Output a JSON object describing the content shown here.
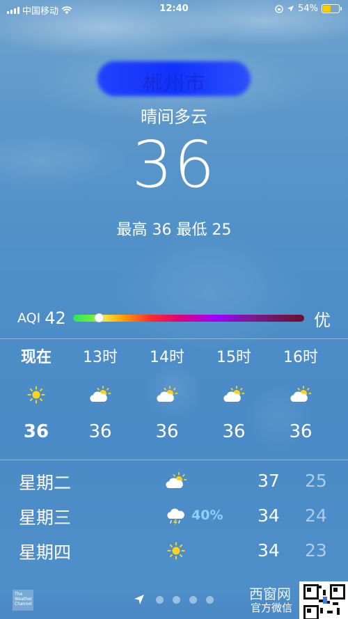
{
  "status_bar": {
    "carrier": "中国移动",
    "time": "12:40",
    "battery_percent": "54%",
    "battery_level": 0.54
  },
  "location": {
    "city_blurred": "郴州市",
    "condition": "晴间多云",
    "temperature": "36",
    "high_low": "最高 36  最低 25"
  },
  "aqi": {
    "label": "AQI",
    "value": "42",
    "quality": "优",
    "level": 0.1
  },
  "hourly": [
    {
      "label": "现在",
      "icon": "sun-icon",
      "temp": "36"
    },
    {
      "label": "13时",
      "icon": "partly-cloudy-icon",
      "temp": "36"
    },
    {
      "label": "14时",
      "icon": "partly-cloudy-icon",
      "temp": "36"
    },
    {
      "label": "15时",
      "icon": "partly-cloudy-icon",
      "temp": "36"
    },
    {
      "label": "16时",
      "icon": "partly-cloudy-icon",
      "temp": "36"
    }
  ],
  "daily": [
    {
      "day": "星期二",
      "icon": "partly-cloudy-icon",
      "pop": "",
      "high": "37",
      "low": "25"
    },
    {
      "day": "星期三",
      "icon": "thunderstorm-icon",
      "pop": "40%",
      "high": "34",
      "low": "24"
    },
    {
      "day": "星期四",
      "icon": "sun-icon",
      "pop": "",
      "high": "34",
      "low": "23"
    }
  ],
  "bottom": {
    "logo_text": "The Weather Channel",
    "watermark": "西窗网",
    "watermark_sub": "官方微信"
  }
}
